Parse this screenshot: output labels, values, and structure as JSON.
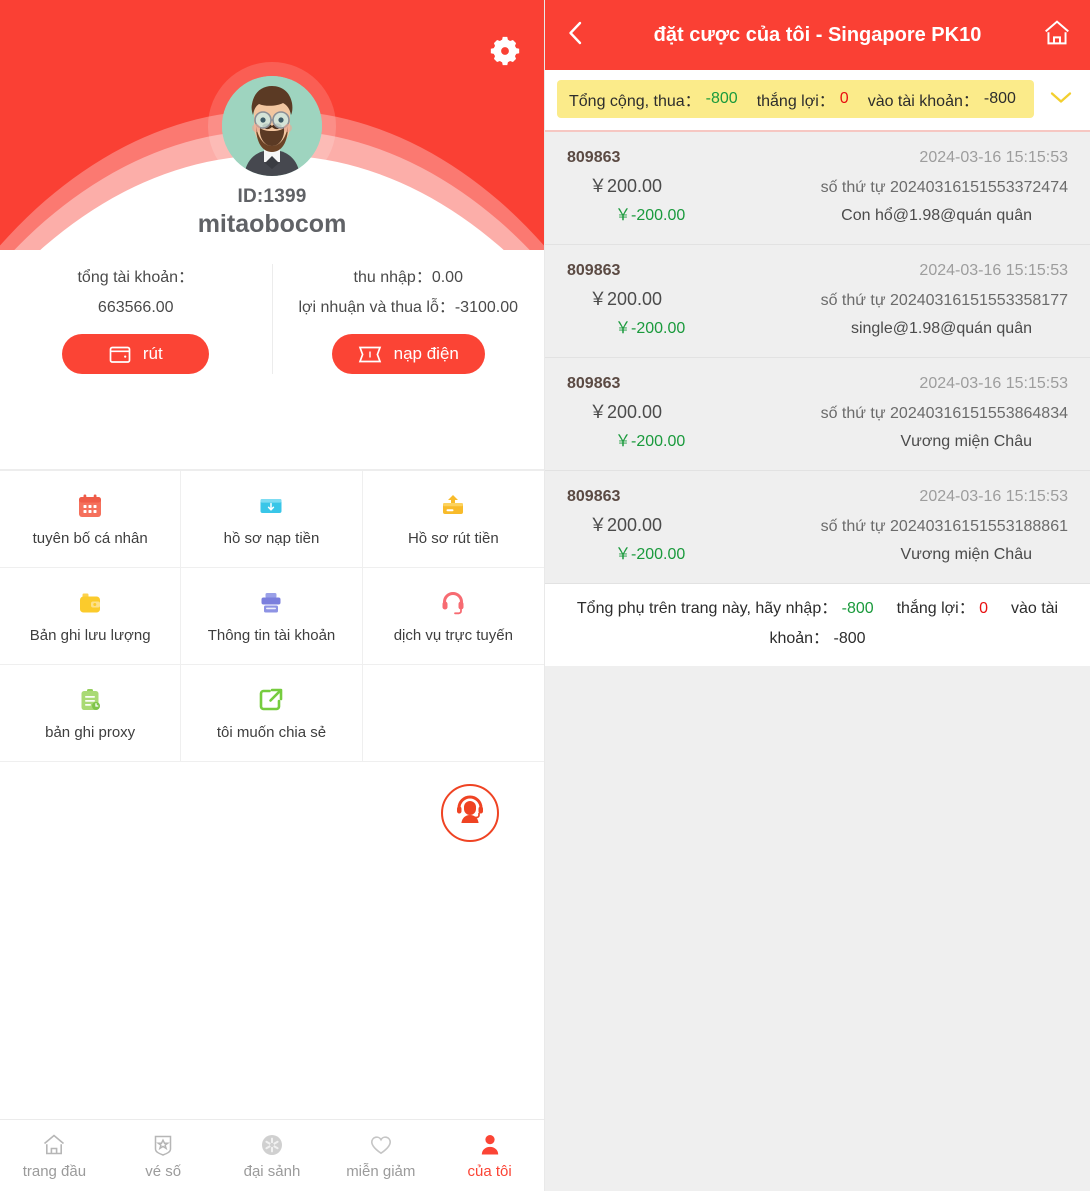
{
  "profile": {
    "gear_icon": "gear-icon",
    "avatar_icon": "avatar-bearded-man",
    "id_label": "ID:1399",
    "username": "mitaobocom",
    "total_balance_label": "tổng tài khoản：",
    "total_balance_value": "663566.00",
    "withdraw_button": "rút",
    "withdraw_icon": "wallet-icon",
    "income_label": "thu nhập：",
    "income_value": "0.00",
    "pnl_label": "lợi nhuận và thua lỗ：",
    "pnl_value": "-3100.00",
    "deposit_button": "nạp điện",
    "deposit_icon": "ticket-icon"
  },
  "menu": {
    "items": [
      {
        "label": "tuyên bố cá nhân",
        "icon": "calendar-icon",
        "color": "#f5705c"
      },
      {
        "label": "hồ sơ nạp tiền",
        "icon": "deposit-card-icon",
        "color": "#39c6e8"
      },
      {
        "label": "Hồ sơ rút tiền",
        "icon": "withdraw-card-icon",
        "color": "#f8bb2a"
      },
      {
        "label": "Bản ghi lưu lượng",
        "icon": "wallet-folder-icon",
        "color": "#fbcb2c"
      },
      {
        "label": "Thông tin tài khoản",
        "icon": "bank-info-icon",
        "color": "#7b7fdd"
      },
      {
        "label": "dịch vụ trực tuyến",
        "icon": "headset-icon",
        "color": "#f76b72"
      },
      {
        "label": "bản ghi proxy",
        "icon": "proxy-record-icon",
        "color": "#94cf5d"
      },
      {
        "label": "tôi muốn chia sẻ",
        "icon": "share-icon",
        "color": "#76cc3e"
      },
      {
        "label": "",
        "icon": "",
        "color": ""
      }
    ]
  },
  "customer_service": {
    "icon": "headset-support-icon"
  },
  "tabbar": {
    "items": [
      {
        "label": "trang đầu",
        "icon": "home-icon",
        "active": false
      },
      {
        "label": "vé số",
        "icon": "lottery-ticket-icon",
        "active": false
      },
      {
        "label": "đại sảnh",
        "icon": "lobby-icon",
        "active": false
      },
      {
        "label": "miễn giảm",
        "icon": "heart-icon",
        "active": false
      },
      {
        "label": "của tôi",
        "icon": "user-icon",
        "active": true
      }
    ]
  },
  "bets_page": {
    "back_icon": "chevron-left-icon",
    "title": "đặt cược của tôi - Singapore PK10",
    "home_icon": "home-outline-icon",
    "chevron_icon": "chevron-down-icon",
    "summary": {
      "loss_label": "Tổng cộng, thua：",
      "loss_value": "-800",
      "win_label": "thắng lợi：",
      "win_value": "0",
      "account_label": "vào tài khoản：",
      "account_value": "-800"
    },
    "rows": [
      {
        "id": "809863",
        "time": "2024-03-16 15:15:53",
        "amount": "￥200.00",
        "serial": "số thứ tự 20240316151553372474",
        "profit": "￥-200.00",
        "desc": "Con hổ@1.98@quán quân"
      },
      {
        "id": "809863",
        "time": "2024-03-16 15:15:53",
        "amount": "￥200.00",
        "serial": "số thứ tự 20240316151553358177",
        "profit": "￥-200.00",
        "desc": "single@1.98@quán quân"
      },
      {
        "id": "809863",
        "time": "2024-03-16 15:15:53",
        "amount": "￥200.00",
        "serial": "số thứ tự 20240316151553864834",
        "profit": "￥-200.00",
        "desc": "Vương miện Châu"
      },
      {
        "id": "809863",
        "time": "2024-03-16 15:15:53",
        "amount": "￥200.00",
        "serial": "số thứ tự 20240316151553188861",
        "profit": "￥-200.00",
        "desc": "Vương miện Châu"
      }
    ],
    "page_total": {
      "prefix": "Tổng phụ trên trang này, hãy nhập：",
      "input_value": "-800",
      "win_label": "thắng lợi：",
      "win_value": "0",
      "account_label": "vào tài khoản：",
      "account_value": "-800"
    }
  },
  "colors": {
    "brand_red": "#fa4034",
    "pill_red": "#fb4435",
    "summary_yellow": "#fbeb8a",
    "green": "#1a9a3c",
    "red_text": "#e81010",
    "panel_gray": "#efefef"
  }
}
